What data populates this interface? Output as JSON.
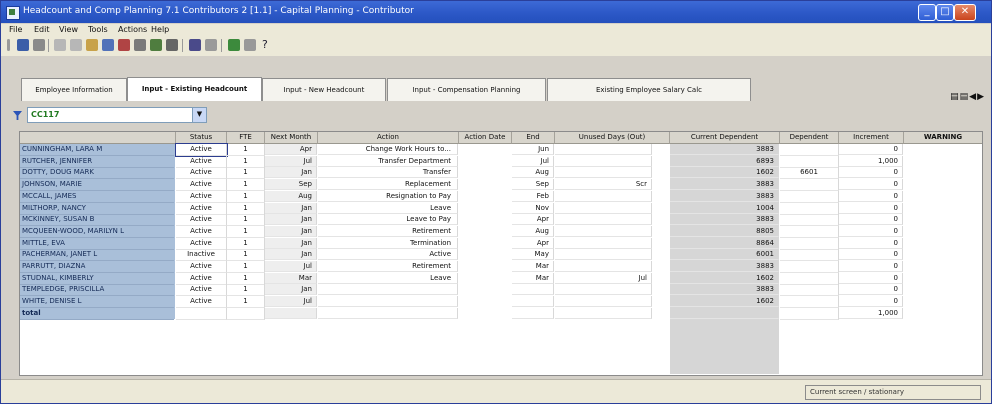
{
  "window": {
    "title": "Headcount and Comp Planning 7.1 Contributors 2 [1.1] - Capital Planning - Contributor"
  },
  "menu": [
    "File",
    "Edit",
    "View",
    "Tools",
    "Actions",
    "Help"
  ],
  "tabs": [
    {
      "label": "Employee Information"
    },
    {
      "label": "Input - Existing Headcount",
      "active": true
    },
    {
      "label": "Input - New Headcount"
    },
    {
      "label": "Input - Compensation Planning"
    },
    {
      "label": "Existing Employee Salary Calc"
    }
  ],
  "filter": {
    "value": "CC117"
  },
  "grid": {
    "headers": {
      "status": "Status",
      "fte": "FTE",
      "next": "Next Month",
      "action": "Action",
      "action_date": "Action Date",
      "end": "End",
      "ue": "Unused Days (Out)",
      "cur": "Current Dependent",
      "dep": "Dependent",
      "inc": "Increment",
      "warn": "WARNING"
    },
    "rows": [
      {
        "name": "CUNNINGHAM, LARA M",
        "status": "Active",
        "fte": "1",
        "next": "Apr",
        "action": "Change Work Hours to...",
        "end": "Jun",
        "ue": "",
        "cur": "3883",
        "dep": "",
        "inc": "0"
      },
      {
        "name": "RUTCHER, JENNIFER",
        "status": "Active",
        "fte": "1",
        "next": "Jul",
        "action": "Transfer Department",
        "end": "Jul",
        "ue": "",
        "cur": "6893",
        "dep": "",
        "inc": "1,000"
      },
      {
        "name": "DOTTY, DOUG MARK",
        "status": "Active",
        "fte": "1",
        "next": "Jan",
        "action": "Transfer",
        "end": "Aug",
        "ue": "",
        "cur": "1602",
        "dep": "6601",
        "inc": "0"
      },
      {
        "name": "JOHNSON, MARIE",
        "status": "Active",
        "fte": "1",
        "next": "Sep",
        "action": "Replacement",
        "end": "Sep",
        "ue": "Scr",
        "cur": "3883",
        "dep": "",
        "inc": "0"
      },
      {
        "name": "MCCALL, JAMES",
        "status": "Active",
        "fte": "1",
        "next": "Aug",
        "action": "Resignation to Pay",
        "end": "Feb",
        "ue": "",
        "cur": "3883",
        "dep": "",
        "inc": "0"
      },
      {
        "name": "MILTHORP, NANCY",
        "status": "Active",
        "fte": "1",
        "next": "Jan",
        "action": "Leave",
        "end": "Nov",
        "ue": "",
        "cur": "1004",
        "dep": "",
        "inc": "0"
      },
      {
        "name": "MCKINNEY, SUSAN B",
        "status": "Active",
        "fte": "1",
        "next": "Jan",
        "action": "Leave to Pay",
        "end": "Apr",
        "ue": "",
        "cur": "3883",
        "dep": "",
        "inc": "0"
      },
      {
        "name": "MCQUEEN-WOOD, MARILYN L",
        "status": "Active",
        "fte": "1",
        "next": "Jan",
        "action": "Retirement",
        "end": "Aug",
        "ue": "",
        "cur": "8805",
        "dep": "",
        "inc": "0"
      },
      {
        "name": "MITTLE, EVA",
        "status": "Active",
        "fte": "1",
        "next": "Jan",
        "action": "Termination",
        "end": "Apr",
        "ue": "",
        "cur": "8864",
        "dep": "",
        "inc": "0"
      },
      {
        "name": "PACHERMAN, JANET L",
        "status": "Inactive",
        "fte": "1",
        "next": "Jan",
        "action": "Active",
        "end": "May",
        "ue": "",
        "cur": "6001",
        "dep": "",
        "inc": "0"
      },
      {
        "name": "PARRUTT, DIAZNA",
        "status": "Active",
        "fte": "1",
        "next": "Jul",
        "action": "Retirement",
        "end": "Mar",
        "ue": "",
        "cur": "3883",
        "dep": "",
        "inc": "0"
      },
      {
        "name": "STUDNAL, KIMBERLY",
        "status": "Active",
        "fte": "1",
        "next": "Mar",
        "action": "Leave",
        "end": "Mar",
        "ue": "Jul",
        "cur": "1602",
        "dep": "",
        "inc": "0"
      },
      {
        "name": "TEMPLEDGE, PRISCILLA",
        "status": "Active",
        "fte": "1",
        "next": "Jan",
        "action": "",
        "end": "",
        "ue": "",
        "cur": "3883",
        "dep": "",
        "inc": "0"
      },
      {
        "name": "WHITE, DENISE L",
        "status": "Active",
        "fte": "1",
        "next": "Jul",
        "action": "",
        "end": "",
        "ue": "",
        "cur": "1602",
        "dep": "",
        "inc": "0"
      },
      {
        "name": "total",
        "status": "",
        "fte": "",
        "next": "",
        "action": "",
        "end": "",
        "ue": "",
        "cur": "",
        "dep": "",
        "inc": "1,000"
      }
    ]
  },
  "statusbar": {
    "text": "Current screen / stationary"
  }
}
